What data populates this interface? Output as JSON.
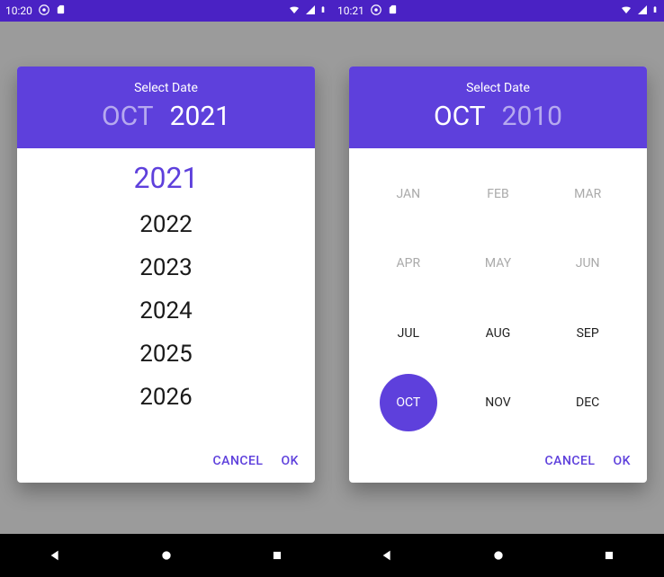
{
  "colors": {
    "accent": "#5e40dc",
    "statusbar": "#4a22c4"
  },
  "left": {
    "status": {
      "time": "10:20"
    },
    "header": {
      "title": "Select Date",
      "month": "OCT",
      "year": "2021"
    },
    "years": [
      "2021",
      "2022",
      "2023",
      "2024",
      "2025",
      "2026"
    ],
    "selected_year": "2021",
    "actions": {
      "cancel": "CANCEL",
      "ok": "OK"
    }
  },
  "right": {
    "status": {
      "time": "10:21"
    },
    "header": {
      "title": "Select Date",
      "month": "OCT",
      "year": "2010"
    },
    "months": [
      "JAN",
      "FEB",
      "MAR",
      "APR",
      "MAY",
      "JUN",
      "JUL",
      "AUG",
      "SEP",
      "OCT",
      "NOV",
      "DEC"
    ],
    "dim_months": [
      "JAN",
      "FEB",
      "MAR",
      "APR",
      "MAY",
      "JUN"
    ],
    "selected_month": "OCT",
    "actions": {
      "cancel": "CANCEL",
      "ok": "OK"
    }
  }
}
